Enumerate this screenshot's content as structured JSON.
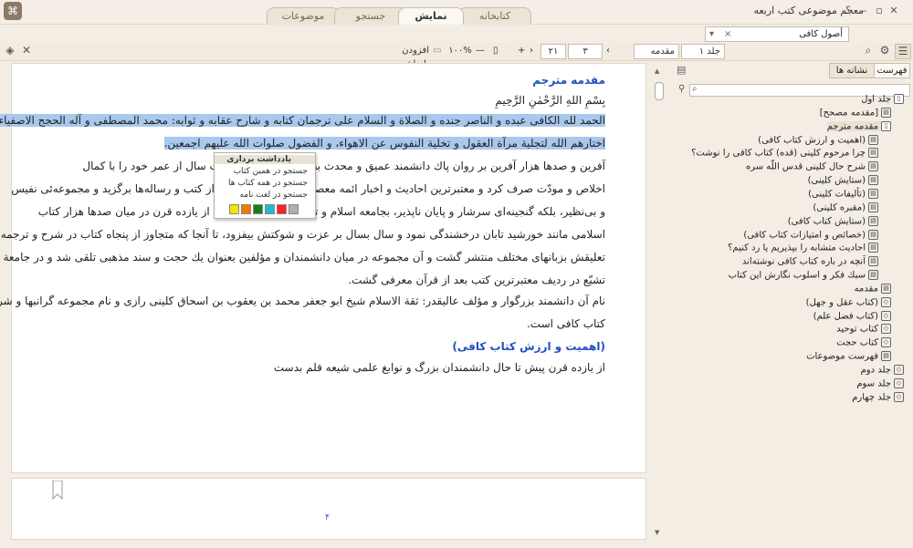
{
  "app": {
    "title": "معجم موضوعی کتب اربعه",
    "logo_glyph": "⌘",
    "window_buttons": {
      "close": "✕",
      "maximize": "▫",
      "minimize": "–",
      "help": "؟"
    }
  },
  "tabs": [
    {
      "label": "کتابخانه",
      "active": false
    },
    {
      "label": "نمایش",
      "active": true
    },
    {
      "label": "جستجو",
      "active": false
    },
    {
      "label": "موضوعات",
      "active": false
    }
  ],
  "book_select": {
    "value": "أصول کافی",
    "clear": "×",
    "dropdown": "▾"
  },
  "toolbar": {
    "volume_label": "جلد ۱",
    "section_label": "مقدمه",
    "page_value": "۳",
    "page_total": "۲۱",
    "nav_plus": "+",
    "nav_prev": "‹",
    "nav_next": "›",
    "zoom_label": "۱۰۰%",
    "zoom_minus": "—",
    "add_note_label": "افزودن یادداشت"
  },
  "content": {
    "heading": "مقدمه مترجم",
    "basmala": "بِسْمِ اللهِ الرَّحْمٰنِ الرَّحِيمِ",
    "lines": [
      "الحمد لله الكافى عبده و الناصر جنده و الصلاة و السلام على ترجمان كتابه و شارح عقابه و ثوابه: محمد المصطفى و آله الحجج الاصفياء",
      "اختارهم الله لتجلية مرآة العقول و تخلية النفوس عن الاهواء، و الفضول صلوات الله عليهم اجمعين.",
      "آفرين و صدها هزار آفرين بر روان پاك دانشمند عميق و محدث بصيرى كه بيش از بيست سال از عمر خود را با كمال",
      "اخلاص و مودّت صرف كرد و معتبرترين احاديث و اخبار ائمه معصومين عليهم السلام را از كتب و رساله‌ها برگزيد و مجموعه‌ئى نفيس",
      "و بى‌نظير، بلكه گنجينه‌اى سرشار و پايان ناپذير، بجامعه اسلام و تشيع تقديم كرد كه پس از يازده قرن در ميان صدها هزار كتاب",
      "اسلامى مانند خورشيد تابان درخشندگى نمود و سال بسال بر عزت و شوكتش بيفزود، تا آنجا كه متجاوز از پنجاه كتاب در شرح و ترجمه و",
      "تعليقش بزبانهاى مختلف منتشر گشت و آن مجموعه در ميان دانشمندان و مؤلفين بعنوان يك حجت و سند مذهبى تلقى شد و در جامعة",
      "تشيّع در رديف معتبرترين كتب بعد از قرآن معرفى گشت.",
      "نام آن دانشمند بزرگوار و مؤلف عاليقدر: ثقة الاسلام شيخ ابو جعفر محمد بن يعقوب بن اسحاق كلينى رازى و نام مجموعه گرانبها و شريفش",
      "كتاب كافى است."
    ],
    "subheading": "(اهميت و ارزش كتاب كافى)",
    "last_line": "از يازده قرن پيش تا حال دانشمندان بزرگ و نوابغ علمى شيعه قلم بدست",
    "page_number": "۴"
  },
  "context_menu": {
    "items": [
      "یادداشت برداری",
      "جستجو در همین کتاب",
      "جستجو در همه کتاب ها",
      "جستجو در لغت نامه"
    ],
    "swatches": [
      "#b0b0b0",
      "#ff2222",
      "#22b8d8",
      "#1e7a1e",
      "#f07a00",
      "#f2e600"
    ]
  },
  "right_panel": {
    "tab_index": "فهرست",
    "tab_bookmarks": "نشانه ها",
    "tree": [
      {
        "label": "جلد اول",
        "level": 0,
        "icon": "book"
      },
      {
        "label": "[مقدمه مصحح]",
        "level": 1,
        "icon": "page"
      },
      {
        "label": "مقدمه مترجم",
        "level": 1,
        "icon": "book",
        "selected": true
      },
      {
        "label": "(اهمیت و ارزش کتاب کافی)",
        "level": 2,
        "icon": "page"
      },
      {
        "label": "چرا مرحوم کلینی (قده) کتاب کافی را نوشت؟",
        "level": 2,
        "icon": "page"
      },
      {
        "label": "شرح حال کلینی قدس اللّه سره",
        "level": 2,
        "icon": "page"
      },
      {
        "label": "(ستایش کلینی)",
        "level": 2,
        "icon": "page"
      },
      {
        "label": "(تألیفات کلینی)",
        "level": 2,
        "icon": "page"
      },
      {
        "label": "(مقبره کلینی)",
        "level": 2,
        "icon": "page"
      },
      {
        "label": "(ستایش کتاب کافی)",
        "level": 2,
        "icon": "page"
      },
      {
        "label": "(خصائص و امتیازات کتاب کافی)",
        "level": 2,
        "icon": "page"
      },
      {
        "label": "احادیث متشابه را بپذیریم یا رد کنیم؟",
        "level": 2,
        "icon": "page"
      },
      {
        "label": "آنچه در باره کتاب کافی نوشته‌اند",
        "level": 2,
        "icon": "page"
      },
      {
        "label": "سبك فكر و اسلوب نگارش این کتاب",
        "level": 2,
        "icon": "page"
      },
      {
        "label": "مقدمه",
        "level": 1,
        "icon": "page"
      },
      {
        "label": "(کتاب عقل و جهل)",
        "level": 1,
        "icon": "closed"
      },
      {
        "label": "(کتاب فضل علم)",
        "level": 1,
        "icon": "closed"
      },
      {
        "label": "کتاب توحید",
        "level": 1,
        "icon": "closed"
      },
      {
        "label": "کتاب حجت",
        "level": 1,
        "icon": "closed"
      },
      {
        "label": "فهرست موضوعات",
        "level": 1,
        "icon": "page"
      },
      {
        "label": "جلد دوم",
        "level": 0,
        "icon": "closed"
      },
      {
        "label": "جلد سوم",
        "level": 0,
        "icon": "closed"
      },
      {
        "label": "جلد چهارم",
        "level": 0,
        "icon": "closed"
      }
    ]
  },
  "colors": {
    "highlight": "#a8c8ee",
    "heading": "#1f4fbf",
    "accent": "#e7dfd0"
  }
}
